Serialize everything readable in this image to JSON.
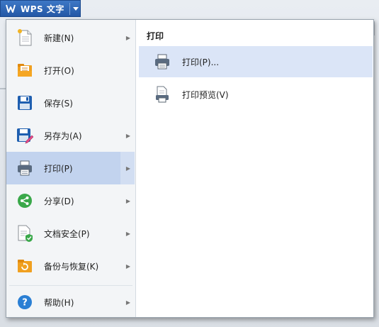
{
  "app": {
    "title": "WPS 文字"
  },
  "menu": {
    "items": [
      {
        "label": "新建(N)",
        "icon": "new-document-icon",
        "has_submenu": true
      },
      {
        "label": "打开(O)",
        "icon": "open-folder-icon",
        "has_submenu": false
      },
      {
        "label": "保存(S)",
        "icon": "save-icon",
        "has_submenu": false
      },
      {
        "label": "另存为(A)",
        "icon": "save-as-icon",
        "has_submenu": true
      },
      {
        "label": "打印(P)",
        "icon": "printer-icon",
        "has_submenu": true,
        "selected": true
      },
      {
        "label": "分享(D)",
        "icon": "share-icon",
        "has_submenu": true
      },
      {
        "label": "文档安全(P)",
        "icon": "document-security-icon",
        "has_submenu": true
      },
      {
        "label": "备份与恢复(K)",
        "icon": "backup-restore-icon",
        "has_submenu": true
      },
      {
        "label": "帮助(H)",
        "icon": "help-icon",
        "has_submenu": true
      }
    ]
  },
  "submenu": {
    "title": "打印",
    "items": [
      {
        "label": "打印(P)...",
        "icon": "printer-icon",
        "highlighted": true
      },
      {
        "label": "打印预览(V)",
        "icon": "print-preview-icon"
      }
    ]
  },
  "colors": {
    "app_button": "#2d64b4",
    "selected_item": "#c2d3ee",
    "hover_item": "#dbe5f7"
  }
}
